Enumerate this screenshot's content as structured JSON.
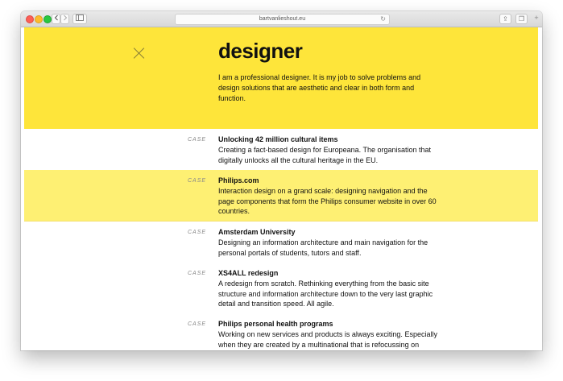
{
  "browser": {
    "url": "bartvanlieshout.eu",
    "back_icon": "chevron-left-icon",
    "forward_icon": "chevron-right-icon",
    "reload_glyph": "↻",
    "share_glyph": "⇪",
    "tabs_glyph": "❐",
    "new_tab_glyph": "+"
  },
  "hero": {
    "title": "designer",
    "intro": "I am a professional designer. It is my job to solve problems and design solutions that are aesthetic and clear in both form and function."
  },
  "cases": [
    {
      "label": "CASE",
      "title": "Unlocking 42 million cultural items",
      "description": "Creating a fact-based design for Europeana. The organisation that digitally unlocks all the cultural heritage in the EU.",
      "highlighted": false
    },
    {
      "label": "CASE",
      "title": "Philips.com",
      "description": "Interaction design on a grand scale: designing navigation and the page components that form the Philips consumer website in over 60 countries.",
      "highlighted": true
    },
    {
      "label": "CASE",
      "title": "Amsterdam University",
      "description": "Designing an information architecture and main navigation for the personal portals of students, tutors and staff.",
      "highlighted": false
    },
    {
      "label": "CASE",
      "title": "XS4ALL redesign",
      "description": "A redesign from scratch. Rethinking everything from the basic site structure and information architecture down to the very last graphic detail and transition speed. All agile.",
      "highlighted": false
    },
    {
      "label": "CASE",
      "title": "Philips personal health programs",
      "description": "Working on new services and products is always exciting. Especially when they are created by a multinational that is refocussing on personal care.",
      "highlighted": false
    }
  ],
  "colors": {
    "accent": "#fee53a",
    "highlight": "#fef073"
  }
}
